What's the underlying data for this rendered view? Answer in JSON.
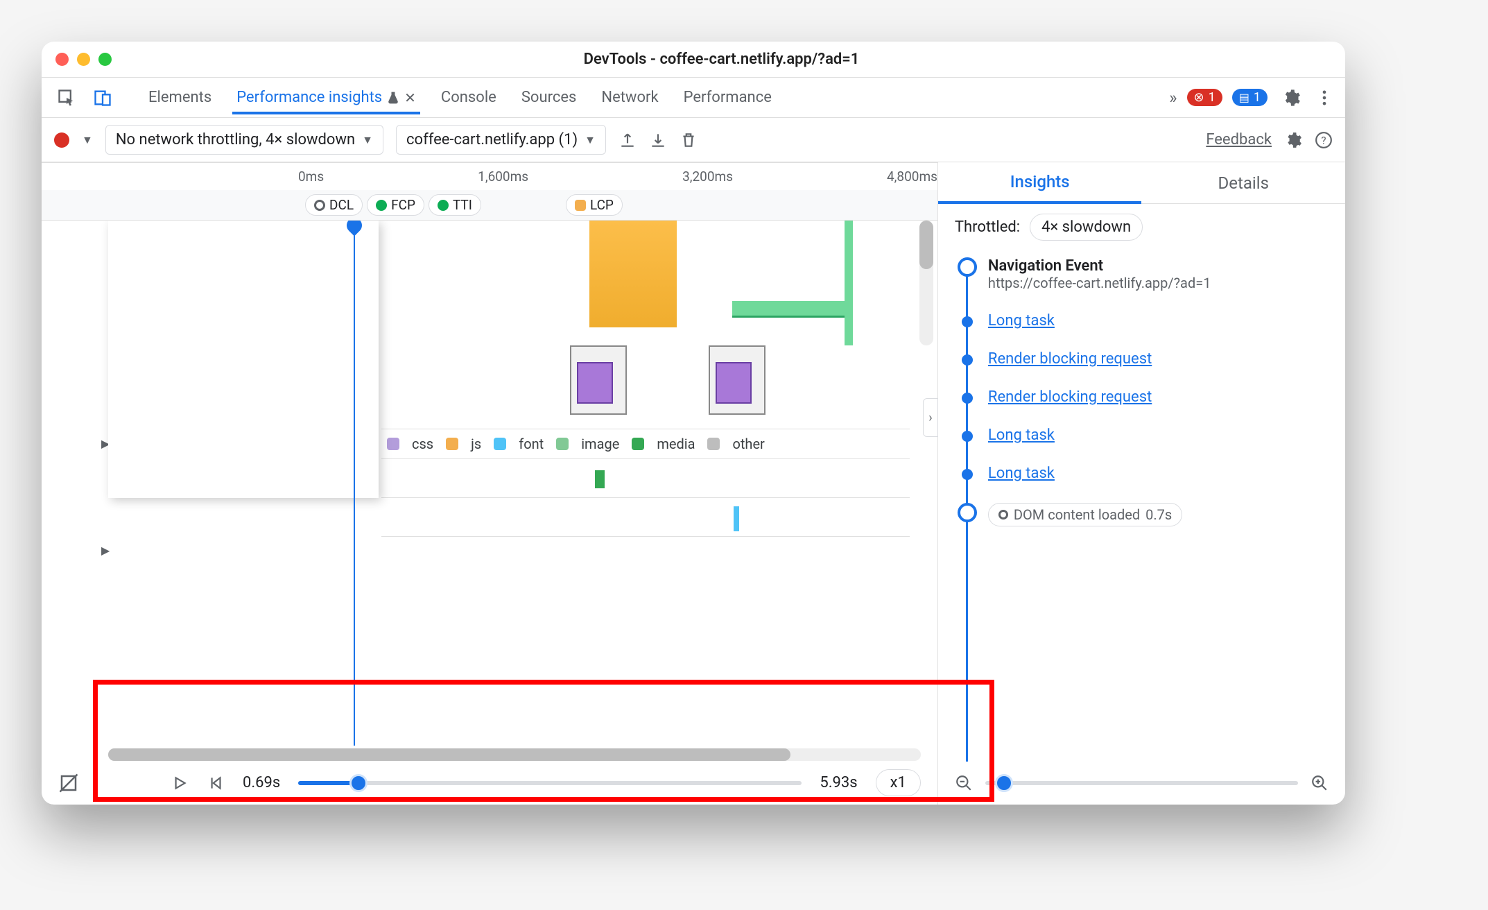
{
  "title": "DevTools - coffee-cart.netlify.app/?ad=1",
  "topTabs": {
    "elements": "Elements",
    "perfInsights": "Performance insights",
    "console": "Console",
    "sources": "Sources",
    "network": "Network",
    "performance": "Performance"
  },
  "errorBadge": "1",
  "infoBadge": "1",
  "toolbar": {
    "throttleSelect": "No network throttling, 4× slowdown",
    "pageSelect": "coffee-cart.netlify.app (1)",
    "feedback": "Feedback"
  },
  "ruler": {
    "t0": "0ms",
    "t1": "1,600ms",
    "t2": "3,200ms",
    "t3": "4,800ms"
  },
  "markers": {
    "dcl": "DCL",
    "fcp": "FCP",
    "tti": "TTI",
    "lcp": "LCP"
  },
  "legend": {
    "css": "css",
    "js": "js",
    "font": "font",
    "image": "image",
    "media": "media",
    "other": "other"
  },
  "playback": {
    "start": "0.69s",
    "end": "5.93s",
    "speed": "x1"
  },
  "sidepanel": {
    "tabs": {
      "insights": "Insights",
      "details": "Details"
    },
    "throttledLabel": "Throttled:",
    "throttledValue": "4× slowdown",
    "navTitle": "Navigation Event",
    "navUrl": "https://coffee-cart.netlify.app/?ad=1",
    "items": {
      "longtask1": "Long task",
      "rbr1": "Render blocking request",
      "rbr2": "Render blocking request",
      "longtask2": "Long task",
      "longtask3": "Long task",
      "dcl": "DOM content loaded",
      "dclTime": "0.7s"
    }
  }
}
